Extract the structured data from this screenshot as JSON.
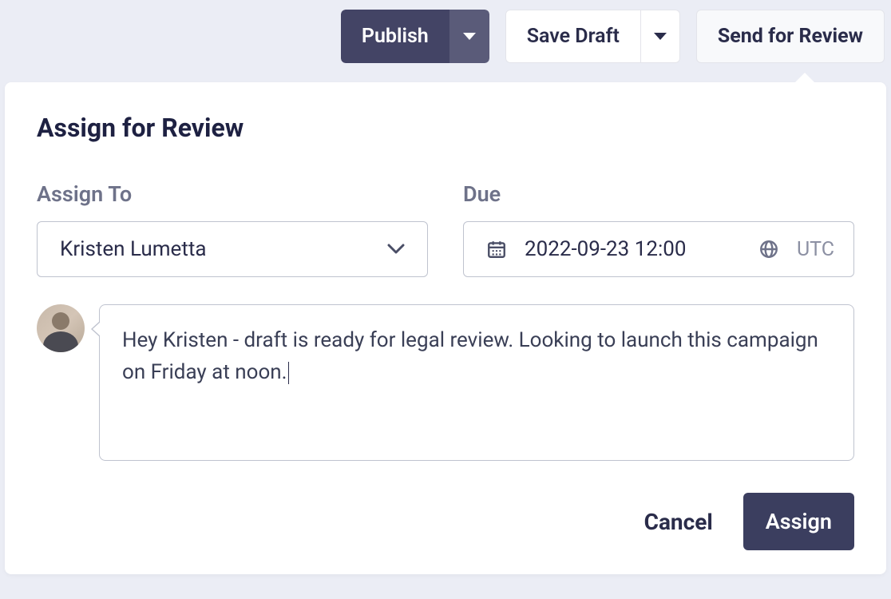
{
  "toolbar": {
    "publish_label": "Publish",
    "save_draft_label": "Save Draft",
    "send_review_label": "Send for Review"
  },
  "panel": {
    "title": "Assign for Review",
    "assign_to": {
      "label": "Assign To",
      "value": "Kristen Lumetta"
    },
    "due": {
      "label": "Due",
      "value": "2022-09-23 12:00",
      "tz": "UTC"
    },
    "comment": {
      "text": "Hey Kristen - draft is ready for legal review. Looking to launch this campaign on Friday at noon."
    },
    "footer": {
      "cancel_label": "Cancel",
      "assign_label": "Assign"
    }
  }
}
